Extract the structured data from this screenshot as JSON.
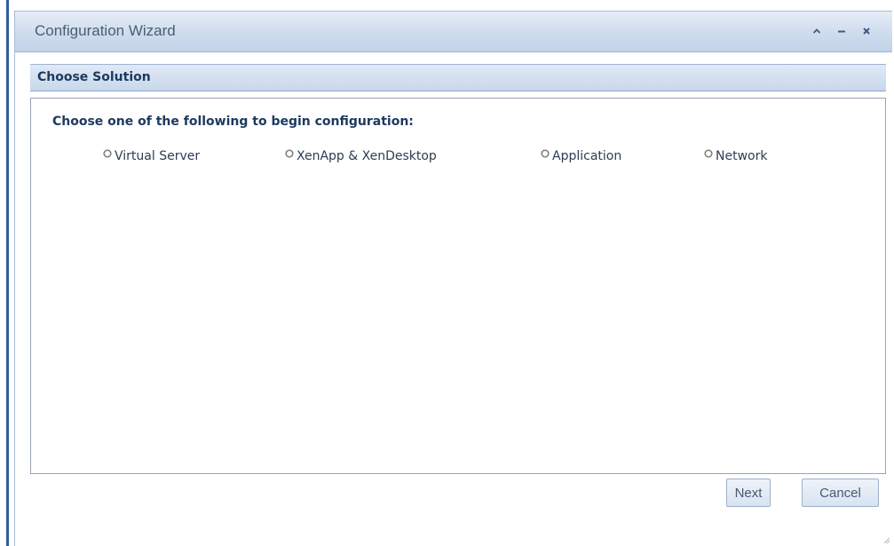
{
  "window": {
    "title": "Configuration Wizard",
    "controls": {
      "collapse_icon": "caret-up-icon",
      "minimize_icon": "minus-icon",
      "close_icon": "close-icon"
    }
  },
  "section": {
    "title": "Choose Solution"
  },
  "content": {
    "instruction": "Choose one of the following to begin configuration:",
    "options": [
      {
        "label": "Virtual Server",
        "selected": false
      },
      {
        "label": "XenApp & XenDesktop",
        "selected": false
      },
      {
        "label": "Application",
        "selected": false
      },
      {
        "label": "Network",
        "selected": false
      }
    ]
  },
  "footer": {
    "next_label": "Next",
    "cancel_label": "Cancel"
  },
  "colors": {
    "accent": "#2f5c9a",
    "header_text": "#1d3a60",
    "title_text": "#4d5d74"
  }
}
